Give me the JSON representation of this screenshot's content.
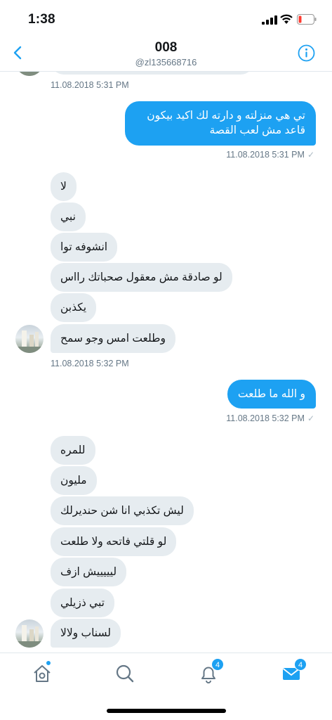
{
  "status_bar": {
    "time": "1:38"
  },
  "header": {
    "title": "008",
    "handle": "@zl135668716"
  },
  "messages": [
    {
      "text": "تي هي منزلته و دارته لك اكيد بيكون"
    },
    {
      "text": "قاعد مش لعب القصة"
    },
    {
      "text": "لا"
    },
    {
      "text": "نبي"
    },
    {
      "text": "انشوفه توا"
    },
    {
      "text": "لو صادقة مش معقول صحباتك رااس"
    },
    {
      "text": "يكذبن"
    },
    {
      "text": "وطلعت امس وجو سمح"
    },
    {
      "text": "و الله ما طلعت"
    },
    {
      "text": "للمره"
    },
    {
      "text": "مليون"
    },
    {
      "text": "ليش تكذبي انا شن حنديرلك"
    },
    {
      "text": "لو قلتي فاتحه ولا طلعت"
    },
    {
      "text": "ليييييش ازف"
    },
    {
      "text": "تبي ذزيلي"
    },
    {
      "text": "لسناب ولالا"
    }
  ],
  "timestamps": {
    "t1": "11.08.2018 5:31 PM",
    "t2": "11.08.2018 5:31 PM",
    "t3": "11.08.2018 5:32 PM",
    "t4": "11.08.2018 5:32 PM"
  },
  "read_mark": "✓",
  "tabs": {
    "notifications_badge": "4",
    "messages_badge": "4"
  },
  "colors": {
    "accent": "#1da1f2",
    "received_bubble": "#e6ecf0",
    "secondary_text": "#657786"
  }
}
